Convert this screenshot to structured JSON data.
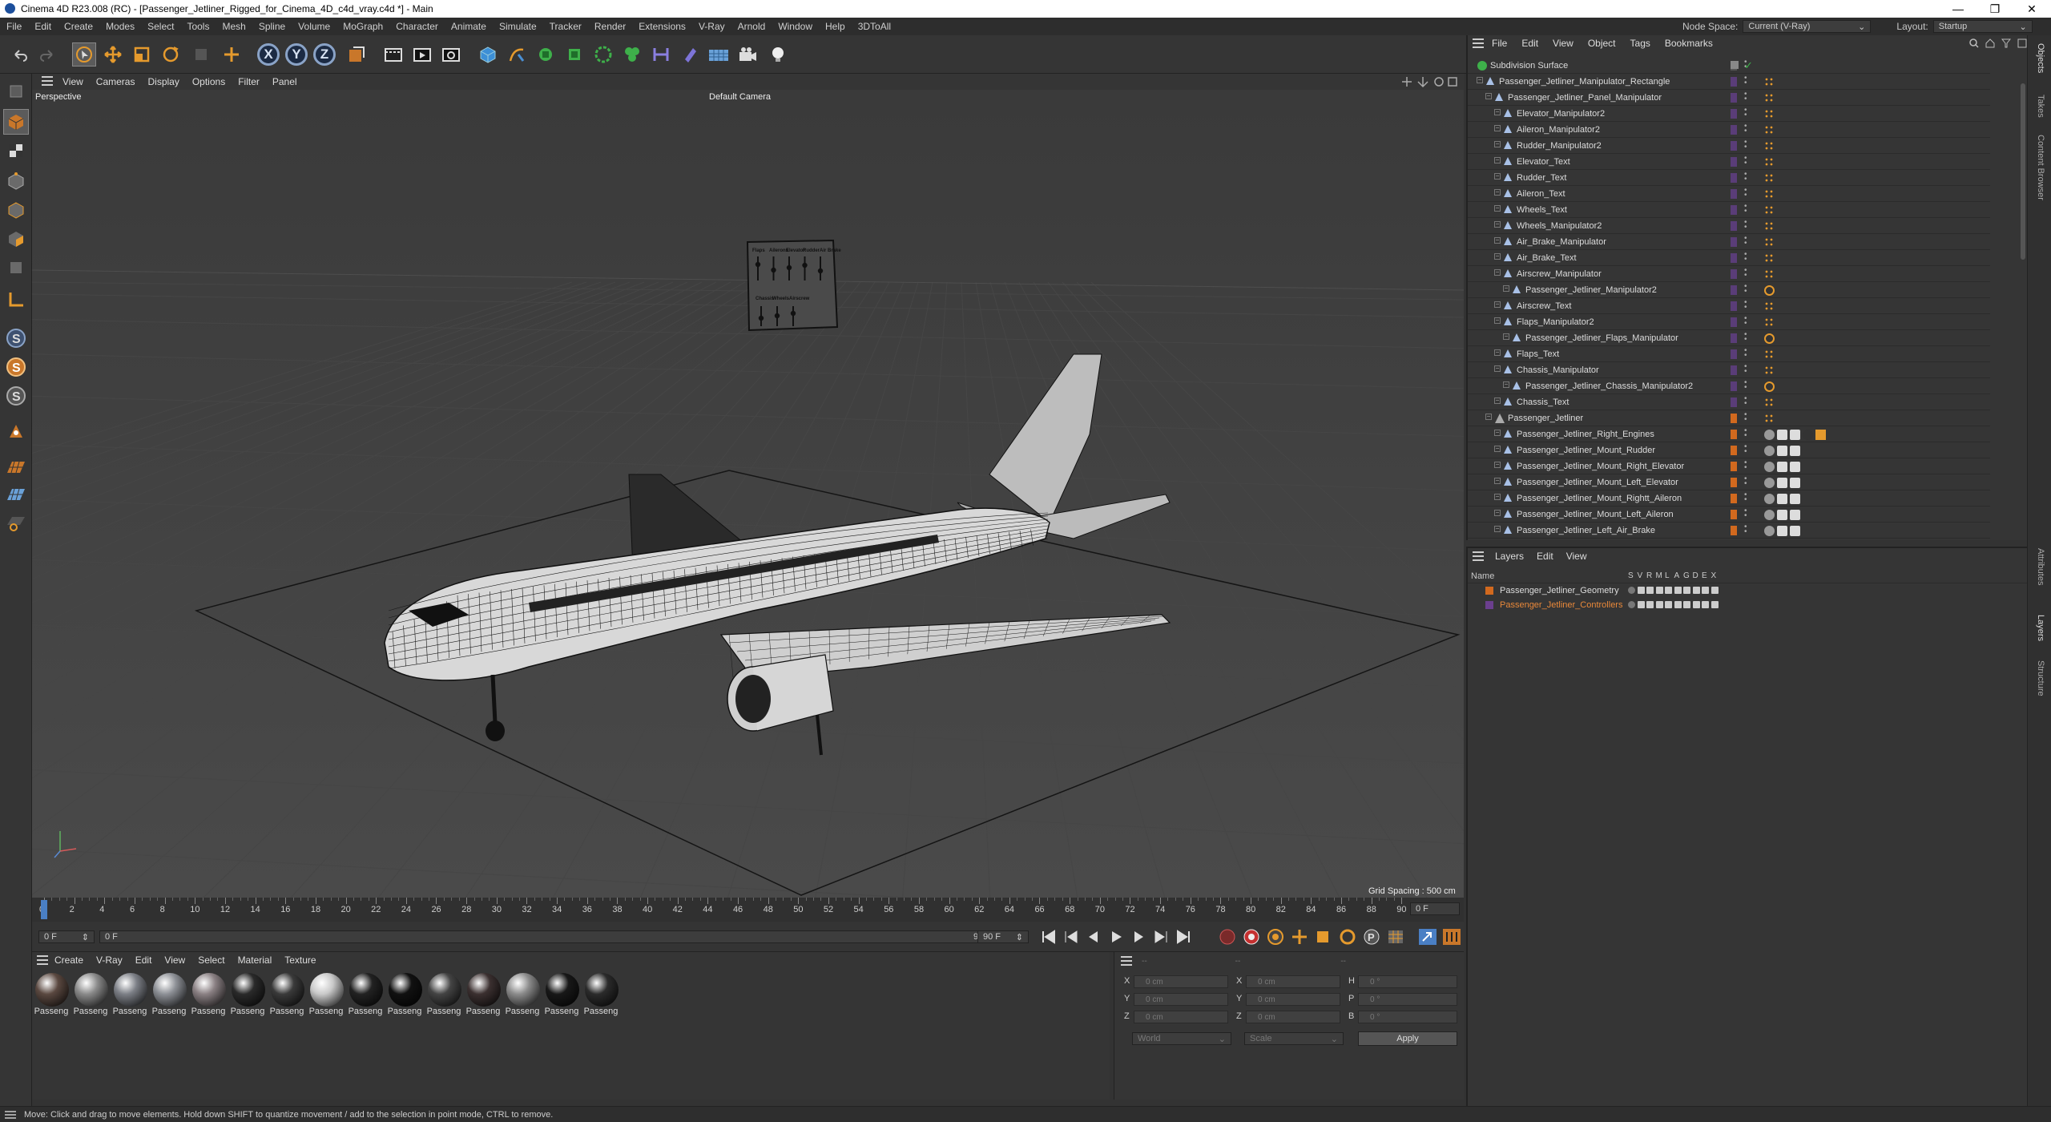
{
  "window": {
    "title": "Cinema 4D R23.008 (RC) - [Passenger_Jetliner_Rigged_for_Cinema_4D_c4d_vray.c4d *] - Main",
    "controls": [
      "—",
      "❐",
      "✕"
    ]
  },
  "menubar": {
    "items": [
      "File",
      "Edit",
      "Create",
      "Modes",
      "Select",
      "Tools",
      "Mesh",
      "Spline",
      "Volume",
      "MoGraph",
      "Character",
      "Animate",
      "Simulate",
      "Tracker",
      "Render",
      "Extensions",
      "V-Ray",
      "Arnold",
      "Window",
      "Help",
      "3DToAll"
    ],
    "node_space_label": "Node Space:",
    "node_space_value": "Current (V-Ray)",
    "layout_label": "Layout:",
    "layout_value": "Startup"
  },
  "toolbar": {
    "axis_x": "X",
    "axis_y": "Y",
    "axis_z": "Z"
  },
  "viewport": {
    "menu": [
      "View",
      "Cameras",
      "Display",
      "Options",
      "Filter",
      "Panel"
    ],
    "projection": "Perspective",
    "camera": "Default Camera",
    "grid_spacing": "Grid Spacing : 500 cm",
    "hud_labels_top": [
      "Flaps",
      "Ailerons",
      "Elevator",
      "Rudder",
      "Air Brake"
    ],
    "hud_labels_bottom": [
      "Chassis",
      "Wheels",
      "Airscrew"
    ]
  },
  "timeline": {
    "ticks": [
      "0",
      "2",
      "4",
      "6",
      "8",
      "10",
      "12",
      "14",
      "16",
      "18",
      "20",
      "22",
      "24",
      "26",
      "28",
      "30",
      "32",
      "34",
      "36",
      "38",
      "40",
      "42",
      "44",
      "46",
      "48",
      "50",
      "52",
      "54",
      "56",
      "58",
      "60",
      "62",
      "64",
      "66",
      "68",
      "70",
      "72",
      "74",
      "76",
      "78",
      "80",
      "82",
      "84",
      "86",
      "88",
      "90"
    ],
    "end_frame": "0 F",
    "current_frame": "0 F",
    "start_field": "0 F",
    "range_end": "90 F",
    "range_end2": "90 F"
  },
  "materials": {
    "menu": [
      "Create",
      "V-Ray",
      "Edit",
      "View",
      "Select",
      "Material",
      "Texture"
    ],
    "items": [
      {
        "label": "Passeng",
        "color": "#5a4840"
      },
      {
        "label": "Passeng",
        "color": "#8a8a8a"
      },
      {
        "label": "Passeng",
        "color": "#7c7f86"
      },
      {
        "label": "Passeng",
        "color": "#8d9096"
      },
      {
        "label": "Passeng",
        "color": "#8a8083"
      },
      {
        "label": "Passeng",
        "color": "#2a2a2a"
      },
      {
        "label": "Passeng",
        "color": "#3a3a3a"
      },
      {
        "label": "Passeng",
        "color": "#c9c9c9"
      },
      {
        "label": "Passeng",
        "color": "#222222"
      },
      {
        "label": "Passeng",
        "color": "#111111"
      },
      {
        "label": "Passeng",
        "color": "#444444"
      },
      {
        "label": "Passeng",
        "color": "#3b3030"
      },
      {
        "label": "Passeng",
        "color": "#8b8b8b"
      },
      {
        "label": "Passeng",
        "color": "#181818"
      },
      {
        "label": "Passeng",
        "color": "#2b2b2b"
      }
    ]
  },
  "attributes": {
    "x_label": "X",
    "y_label": "Y",
    "z_label": "Z",
    "x2_label": "X",
    "y2_label": "Y",
    "z2_label": "Z",
    "h_label": "H",
    "p_label": "P",
    "b_label": "B",
    "pos_x": "0 cm",
    "pos_y": "0 cm",
    "pos_z": "0 cm",
    "size_x": "0 cm",
    "size_y": "0 cm",
    "size_z": "0 cm",
    "rot_h": "0 °",
    "rot_p": "0 °",
    "rot_b": "0 °",
    "coord_mode": "World",
    "size_mode": "Scale",
    "apply": "Apply"
  },
  "objects": {
    "menu": [
      "File",
      "Edit",
      "View",
      "Object",
      "Tags",
      "Bookmarks"
    ],
    "rows": [
      {
        "name": "Subdivision Surface",
        "indent": 0,
        "icon": "subdiv",
        "swatch": "#555555"
      },
      {
        "name": "Passenger_Jetliner_Manipulator_Rectangle",
        "indent": 1,
        "icon": "null",
        "swatch": "#5a3d78"
      },
      {
        "name": "Passenger_Jetliner_Panel_Manipulator",
        "indent": 2,
        "icon": "null",
        "swatch": "#5a3d78"
      },
      {
        "name": "Elevator_Manipulator2",
        "indent": 3,
        "icon": "null",
        "swatch": "#5a3d78"
      },
      {
        "name": "Aileron_Manipulator2",
        "indent": 3,
        "icon": "null",
        "swatch": "#5a3d78"
      },
      {
        "name": "Rudder_Manipulator2",
        "indent": 3,
        "icon": "null",
        "swatch": "#5a3d78"
      },
      {
        "name": "Elevator_Text",
        "indent": 3,
        "icon": "null",
        "swatch": "#5a3d78"
      },
      {
        "name": "Rudder_Text",
        "indent": 3,
        "icon": "null",
        "swatch": "#5a3d78"
      },
      {
        "name": "Aileron_Text",
        "indent": 3,
        "icon": "null",
        "swatch": "#5a3d78"
      },
      {
        "name": "Wheels_Text",
        "indent": 3,
        "icon": "null",
        "swatch": "#5a3d78"
      },
      {
        "name": "Wheels_Manipulator2",
        "indent": 3,
        "icon": "null",
        "swatch": "#5a3d78"
      },
      {
        "name": "Air_Brake_Manipulator",
        "indent": 3,
        "icon": "null",
        "swatch": "#5a3d78"
      },
      {
        "name": "Air_Brake_Text",
        "indent": 3,
        "icon": "null",
        "swatch": "#5a3d78"
      },
      {
        "name": "Airscrew_Manipulator",
        "indent": 3,
        "icon": "null",
        "swatch": "#5a3d78"
      },
      {
        "name": "Passenger_Jetliner_Manipulator2",
        "indent": 4,
        "icon": "null",
        "swatch": "#5a3d78"
      },
      {
        "name": "Airscrew_Text",
        "indent": 3,
        "icon": "null",
        "swatch": "#5a3d78"
      },
      {
        "name": "Flaps_Manipulator2",
        "indent": 3,
        "icon": "null",
        "swatch": "#5a3d78"
      },
      {
        "name": "Passenger_Jetliner_Flaps_Manipulator",
        "indent": 4,
        "icon": "null",
        "swatch": "#5a3d78"
      },
      {
        "name": "Flaps_Text",
        "indent": 3,
        "icon": "null",
        "swatch": "#5a3d78"
      },
      {
        "name": "Chassis_Manipulator",
        "indent": 3,
        "icon": "null",
        "swatch": "#5a3d78"
      },
      {
        "name": "Passenger_Jetliner_Chassis_Manipulator2",
        "indent": 4,
        "icon": "null",
        "swatch": "#5a3d78"
      },
      {
        "name": "Chassis_Text",
        "indent": 3,
        "icon": "null",
        "swatch": "#5a3d78"
      },
      {
        "name": "Passenger_Jetliner",
        "indent": 2,
        "icon": "group",
        "swatch": "#d2691e"
      },
      {
        "name": "Passenger_Jetliner_Right_Engines",
        "indent": 3,
        "icon": "null",
        "swatch": "#d2691e"
      },
      {
        "name": "Passenger_Jetliner_Mount_Rudder",
        "indent": 3,
        "icon": "null",
        "swatch": "#d2691e"
      },
      {
        "name": "Passenger_Jetliner_Mount_Right_Elevator",
        "indent": 3,
        "icon": "null",
        "swatch": "#d2691e"
      },
      {
        "name": "Passenger_Jetliner_Mount_Left_Elevator",
        "indent": 3,
        "icon": "null",
        "swatch": "#d2691e"
      },
      {
        "name": "Passenger_Jetliner_Mount_Rightt_Aileron",
        "indent": 3,
        "icon": "null",
        "swatch": "#d2691e"
      },
      {
        "name": "Passenger_Jetliner_Mount_Left_Aileron",
        "indent": 3,
        "icon": "null",
        "swatch": "#d2691e"
      },
      {
        "name": "Passenger_Jetliner_Left_Air_Brake",
        "indent": 3,
        "icon": "null",
        "swatch": "#d2691e"
      }
    ]
  },
  "layers": {
    "menu": [
      "Layers",
      "Edit",
      "View"
    ],
    "name_header": "Name",
    "flags": [
      "S",
      "V",
      "R",
      "M",
      "L",
      "A",
      "G",
      "D",
      "E",
      "X"
    ],
    "rows": [
      {
        "name": "Passenger_Jetliner_Geometry",
        "color": "#d2691e",
        "text_color": "#dcdcdc"
      },
      {
        "name": "Passenger_Jetliner_Controllers",
        "color": "#6b3f8e",
        "text_color": "#e8883a"
      }
    ]
  },
  "side_tabs": [
    "Objects",
    "Takes",
    "Content Browser",
    "Attributes",
    "Layers",
    "Structure"
  ],
  "status": "Move: Click and drag to move elements. Hold down SHIFT to quantize movement / add to the selection in point mode, CTRL to remove."
}
